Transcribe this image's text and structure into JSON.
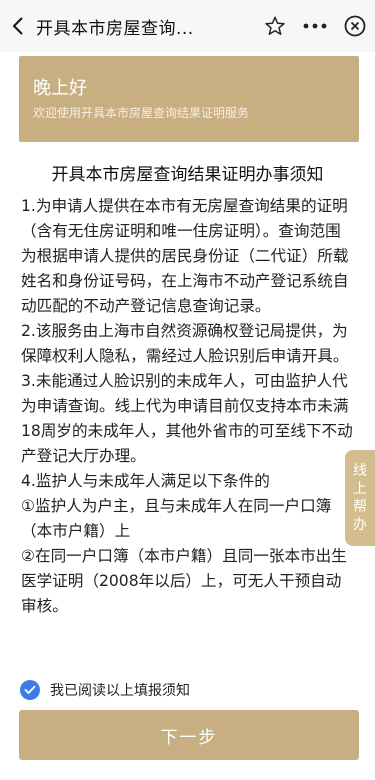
{
  "topbar": {
    "title": "开具本市房屋查询...",
    "icons": [
      "back-arrow-icon",
      "star-icon",
      "more-icon",
      "close-icon"
    ]
  },
  "banner": {
    "greeting": "晚上好",
    "subtitle": "欢迎使用开具本市房屋查询结果证明服务"
  },
  "notice": {
    "title": "开具本市房屋查询结果证明办事须知",
    "paragraphs": [
      "1.为申请人提供在本市有无房屋查询结果的证明（含有无住房证明和唯一住房证明）。查询范围为根据申请人提供的居民身份证（二代证）所载姓名和身份证号码，在上海市不动产登记系统自动匹配的不动产登记信息查询记录。",
      "2.该服务由上海市自然资源确权登记局提供，为保障权利人隐私，需经过人脸识别后申请开具。",
      "3.未能通过人脸识别的未成年人，可由监护人代为申请查询。线上代为申请目前仅支持本市未满18周岁的未成年人，其他外省市的可至线下不动产登记大厅办理。",
      "4.监护人与未成年人满足以下条件的",
      "①监护人为户主，且与未成年人在同一户口簿（本市户籍）上",
      "②在同一户口簿（本市户籍）且同一张本市出生医学证明（2008年以后）上，可无人干预自动审核。"
    ]
  },
  "help_tab": {
    "label": "线上帮办"
  },
  "agree": {
    "label": "我已阅读以上填报须知",
    "checked": true
  },
  "next_button": {
    "label": "下一步"
  },
  "colors": {
    "accent": "#c8af82",
    "check": "#3b7ce6",
    "help_tab": "#d3bc8e"
  }
}
